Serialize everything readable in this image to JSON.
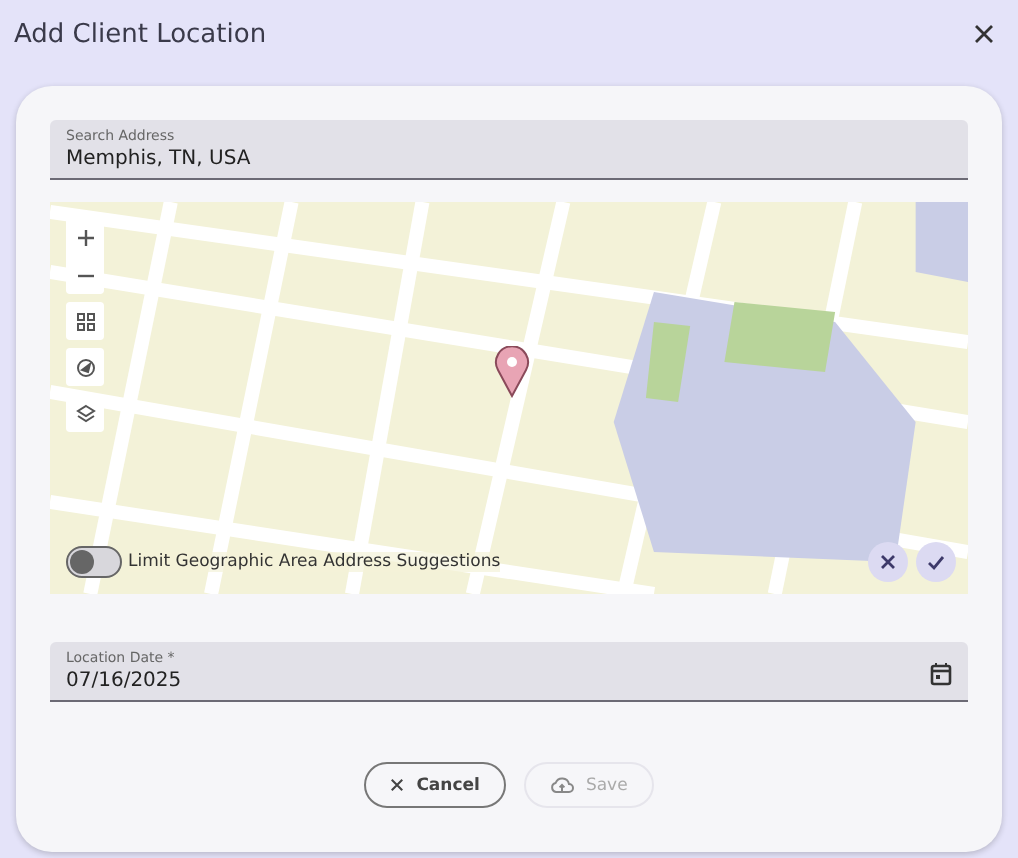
{
  "window": {
    "title": "Add Client Location"
  },
  "search_field": {
    "label": "Search Address",
    "value": "Memphis, TN, USA"
  },
  "map": {
    "limit_toggle": {
      "label": "Limit Geographic Area Address Suggestions",
      "on": false
    }
  },
  "date_field": {
    "label": "Location Date *",
    "value": "07/16/2025"
  },
  "buttons": [
    {
      "label": "Cancel",
      "kind": "cancel",
      "disabled": false
    },
    {
      "label": "Save",
      "kind": "save",
      "disabled": true
    }
  ]
}
